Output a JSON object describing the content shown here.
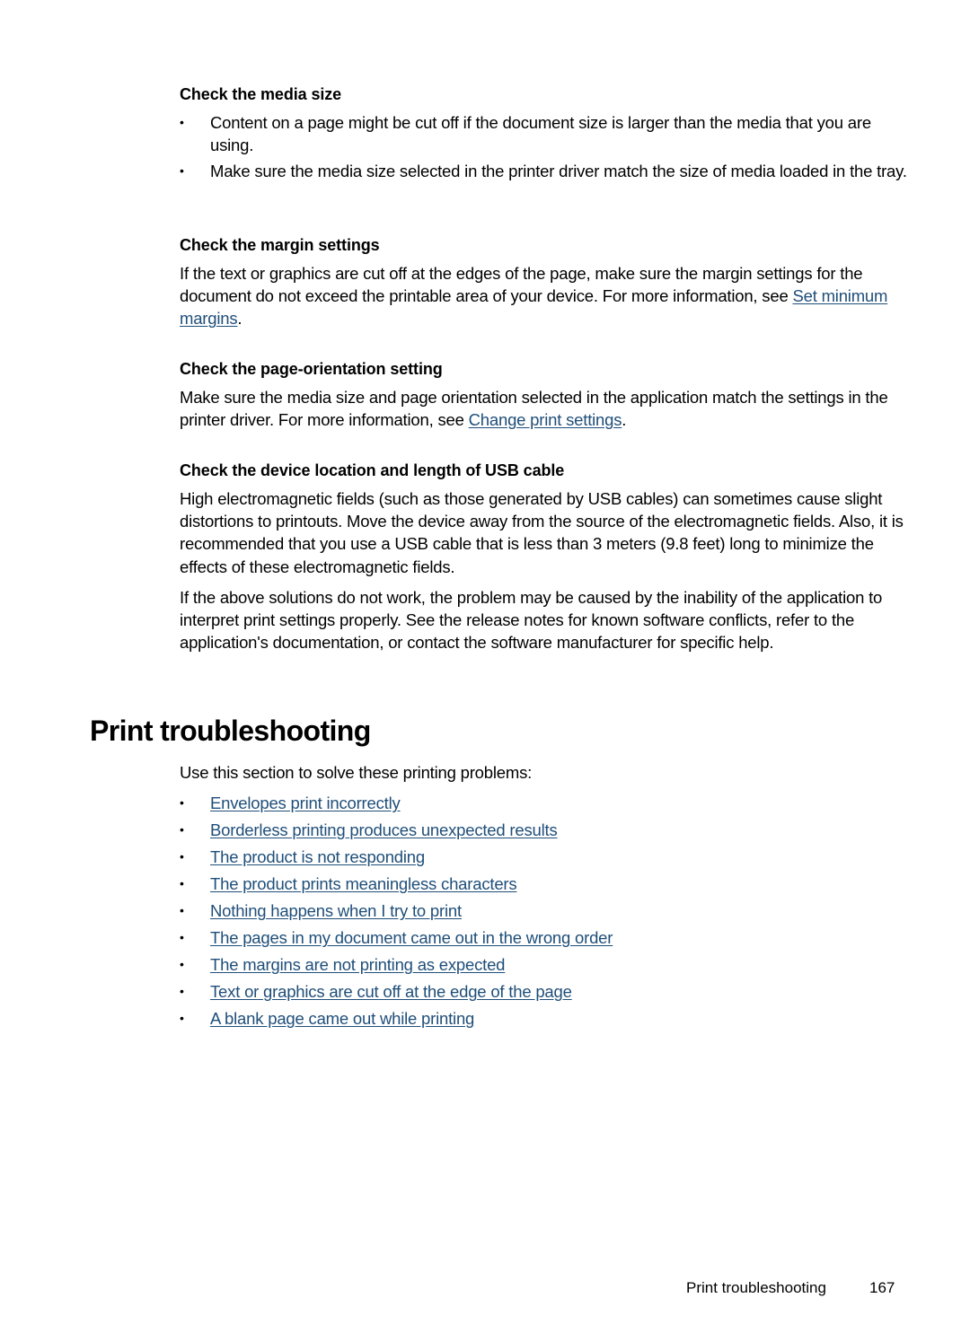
{
  "sections": {
    "media_size": {
      "heading": "Check the media size",
      "bullets": [
        "Content on a page might be cut off if the document size is larger than the media that you are using.",
        "Make sure the media size selected in the printer driver match the size of media loaded in the tray."
      ]
    },
    "margin_settings": {
      "heading": "Check the margin settings",
      "text_before": "If the text or graphics are cut off at the edges of the page, make sure the margin settings for the document do not exceed the printable area of your device. For more information, see ",
      "link": "Set minimum margins",
      "text_after": "."
    },
    "page_orientation": {
      "heading": "Check the page-orientation setting",
      "text_before": "Make sure the media size and page orientation selected in the application match the settings in the printer driver. For more information, see ",
      "link": "Change print settings",
      "text_after": "."
    },
    "usb_cable": {
      "heading": "Check the device location and length of USB cable",
      "paragraph1": "High electromagnetic fields (such as those generated by USB cables) can sometimes cause slight distortions to printouts. Move the device away from the source of the electromagnetic fields. Also, it is recommended that you use a USB cable that is less than 3 meters (9.8 feet) long to minimize the effects of these electromagnetic fields.",
      "paragraph2": "If the above solutions do not work, the problem may be caused by the inability of the application to interpret print settings properly. See the release notes for known software conflicts, refer to the application's documentation, or contact the software manufacturer for specific help."
    }
  },
  "print_troubleshooting": {
    "title": "Print troubleshooting",
    "intro": "Use this section to solve these printing problems:",
    "links": [
      "Envelopes print incorrectly",
      "Borderless printing produces unexpected results",
      "The product is not responding",
      "The product prints meaningless characters",
      "Nothing happens when I try to print",
      "The pages in my document came out in the wrong order",
      "The margins are not printing as expected",
      "Text or graphics are cut off at the edge of the page",
      "A blank page came out while printing"
    ]
  },
  "footer": {
    "section": "Print troubleshooting",
    "page_number": "167"
  },
  "colors": {
    "link": "#1f4e79",
    "text": "#000000"
  }
}
